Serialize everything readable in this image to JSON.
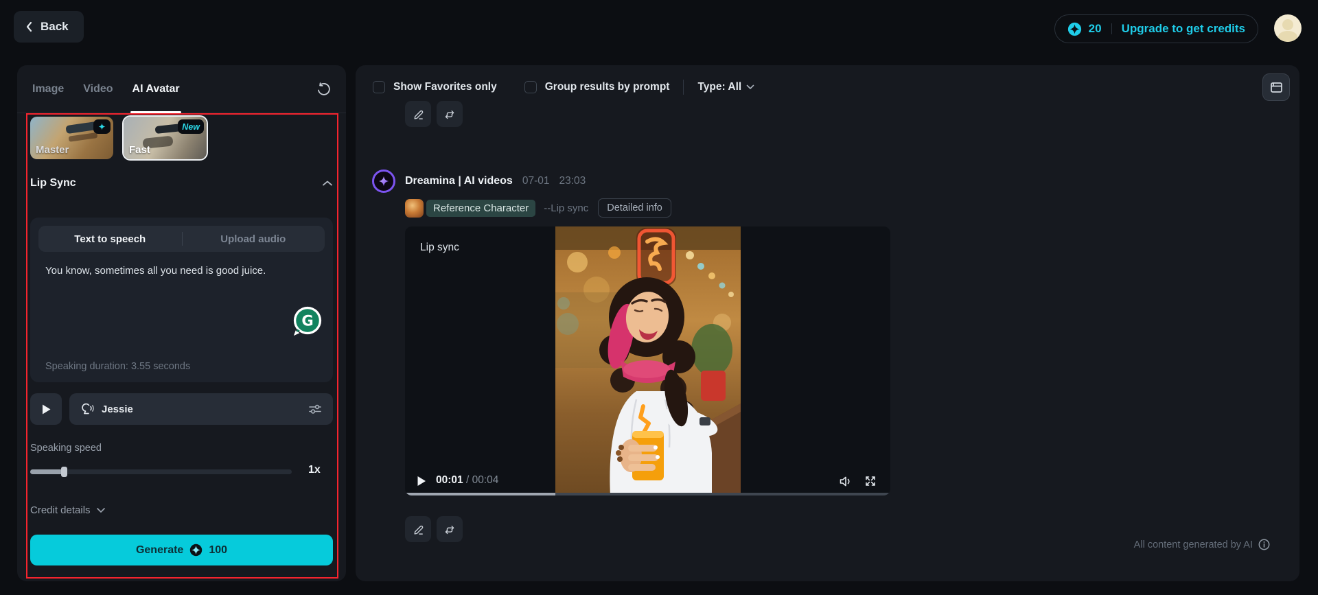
{
  "topbar": {
    "back_label": "Back",
    "credits": "20",
    "upgrade_label": "Upgrade to get credits"
  },
  "sidebar": {
    "tabs": [
      {
        "label": "Image",
        "active": false
      },
      {
        "label": "Video",
        "active": false
      },
      {
        "label": "AI Avatar",
        "active": true
      }
    ],
    "models": [
      {
        "label": "Master",
        "badge_icon": "sparkle-icon"
      },
      {
        "label": "Fast",
        "badge": "New",
        "selected": true
      }
    ],
    "section_title": "Lip Sync",
    "mode_tabs": [
      {
        "label": "Text to speech",
        "active": true
      },
      {
        "label": "Upload audio",
        "active": false
      }
    ],
    "script_text": "You know, sometimes all you need is good juice.",
    "duration_text": "Speaking duration: 3.55 seconds",
    "voice_name": "Jessie",
    "speed_label": "Speaking speed",
    "speed_value": "1x",
    "credit_details_label": "Credit details",
    "generate_label": "Generate",
    "generate_cost": "100"
  },
  "main": {
    "filters": {
      "favorites_label": "Show Favorites only",
      "group_label": "Group results by prompt",
      "type_label": "Type: All"
    },
    "result": {
      "app_name": "Dreamina | AI videos",
      "date": "07-01",
      "time": "23:03",
      "tag_label": "Reference Character",
      "prompt_suffix": "--Lip sync",
      "detail_button_label": "Detailed info",
      "video_overlay_label": "Lip sync",
      "player": {
        "current_time": "00:01",
        "separator": "/",
        "total_time": "00:04",
        "progress_percent": 31
      }
    },
    "footer_note": "All content generated by AI"
  },
  "colors": {
    "accent_cyan": "#06cbdb",
    "link_cyan": "#1fcde9",
    "red_outline": "#f5242e",
    "panel_bg": "#16191f",
    "card_bg": "#1d222b",
    "control_bg": "#272d37",
    "tag_bg": "#2b4543",
    "grammarly_green": "#12835f",
    "logo_purple": "#7c54f0"
  },
  "icons": {
    "back": "chevron-left-icon",
    "credit_coin": "four-point-star-coin-icon",
    "refresh": "refresh-icon",
    "sparkle": "sparkle-icon",
    "collapse": "chevron-up-icon",
    "grammarly": "grammarly-g-icon",
    "play": "play-icon",
    "voice": "speaking-head-icon",
    "voice_settings": "sliders-icon",
    "dropdown": "chevron-down-icon",
    "edit": "pencil-icon",
    "regenerate": "repeat-icon",
    "folder": "folder-icon",
    "volume": "speaker-icon",
    "fullscreen": "expand-icon",
    "info": "info-circle-icon"
  }
}
